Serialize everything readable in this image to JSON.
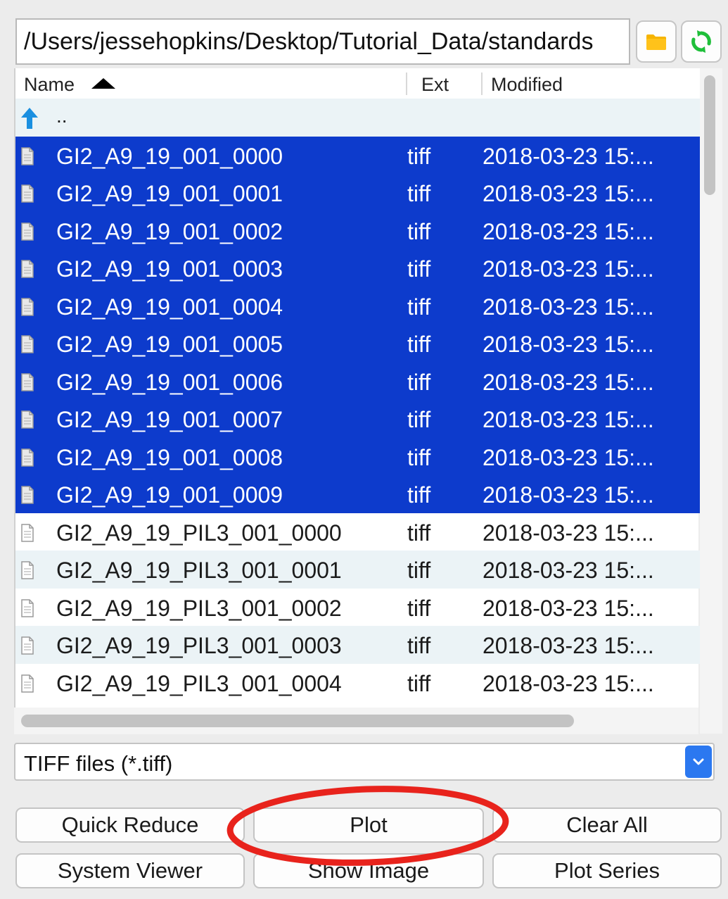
{
  "path_bar": {
    "value": "/Users/jessehopkins/Desktop/Tutorial_Data/standards"
  },
  "toolbar": {
    "open_folder_icon": "folder-icon",
    "refresh_icon": "refresh-icon"
  },
  "file_list": {
    "columns": {
      "name": "Name",
      "ext": "Ext",
      "modified": "Modified"
    },
    "sort": {
      "column": "Name",
      "direction": "ascending"
    },
    "parent_label": "..",
    "rows": [
      {
        "name": "GI2_A9_19_001_0000",
        "ext": "tiff",
        "modified": "2018-03-23 15:...",
        "selected": true
      },
      {
        "name": "GI2_A9_19_001_0001",
        "ext": "tiff",
        "modified": "2018-03-23 15:...",
        "selected": true
      },
      {
        "name": "GI2_A9_19_001_0002",
        "ext": "tiff",
        "modified": "2018-03-23 15:...",
        "selected": true
      },
      {
        "name": "GI2_A9_19_001_0003",
        "ext": "tiff",
        "modified": "2018-03-23 15:...",
        "selected": true
      },
      {
        "name": "GI2_A9_19_001_0004",
        "ext": "tiff",
        "modified": "2018-03-23 15:...",
        "selected": true
      },
      {
        "name": "GI2_A9_19_001_0005",
        "ext": "tiff",
        "modified": "2018-03-23 15:...",
        "selected": true
      },
      {
        "name": "GI2_A9_19_001_0006",
        "ext": "tiff",
        "modified": "2018-03-23 15:...",
        "selected": true
      },
      {
        "name": "GI2_A9_19_001_0007",
        "ext": "tiff",
        "modified": "2018-03-23 15:...",
        "selected": true
      },
      {
        "name": "GI2_A9_19_001_0008",
        "ext": "tiff",
        "modified": "2018-03-23 15:...",
        "selected": true
      },
      {
        "name": "GI2_A9_19_001_0009",
        "ext": "tiff",
        "modified": "2018-03-23 15:...",
        "selected": true
      },
      {
        "name": "GI2_A9_19_PIL3_001_0000",
        "ext": "tiff",
        "modified": "2018-03-23 15:...",
        "selected": false
      },
      {
        "name": "GI2_A9_19_PIL3_001_0001",
        "ext": "tiff",
        "modified": "2018-03-23 15:...",
        "selected": false
      },
      {
        "name": "GI2_A9_19_PIL3_001_0002",
        "ext": "tiff",
        "modified": "2018-03-23 15:...",
        "selected": false
      },
      {
        "name": "GI2_A9_19_PIL3_001_0003",
        "ext": "tiff",
        "modified": "2018-03-23 15:...",
        "selected": false
      },
      {
        "name": "GI2_A9_19_PIL3_001_0004",
        "ext": "tiff",
        "modified": "2018-03-23 15:...",
        "selected": false
      }
    ]
  },
  "filter": {
    "selected": "TIFF files (*.tiff)"
  },
  "buttons": {
    "quick_reduce": "Quick Reduce",
    "plot": "Plot",
    "clear_all": "Clear All",
    "system_viewer": "System Viewer",
    "show_image": "Show Image",
    "plot_series": "Plot Series"
  },
  "colors": {
    "selection": "#0d3bcc",
    "alt_row": "#ebf3f6",
    "annotation": "#e8231c",
    "up_arrow": "#1a8fe0",
    "folder": "#f6b400",
    "refresh": "#1fbf3a",
    "select_arrow_bg": "#2b78f0"
  }
}
